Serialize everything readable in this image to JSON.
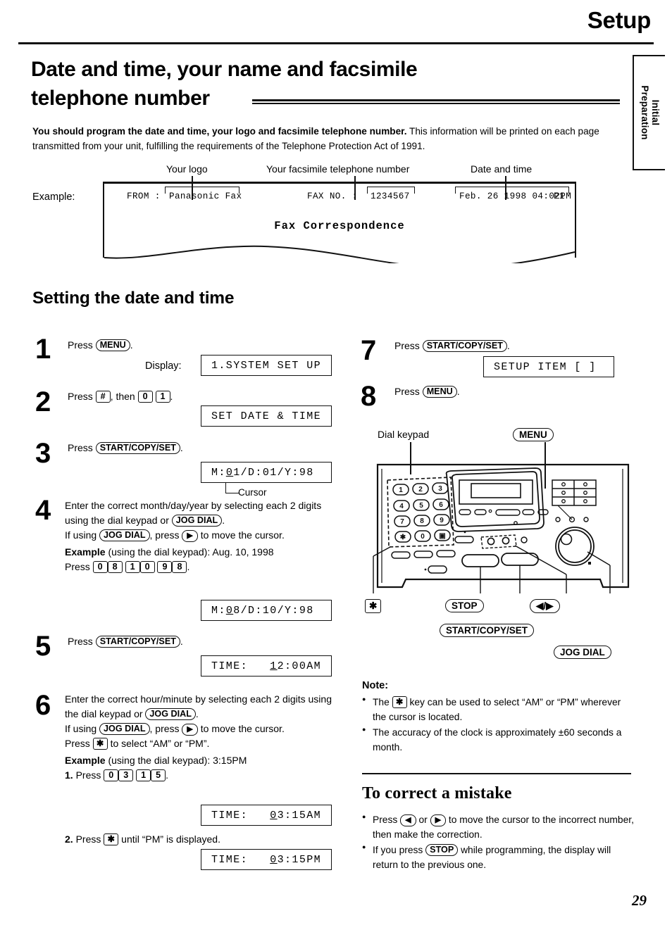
{
  "header": {
    "title": "Setup",
    "side_tab": "Initial\nPreparation",
    "side_tab_line1": "Initial",
    "side_tab_line2": "Preparation"
  },
  "section": {
    "title_line1": "Date and time, your name and facsimile",
    "title_line2": "telephone number",
    "intro_bold": "You should program the date and time, your logo and facsimile telephone number.",
    "intro_rest": " This information will be printed on each page transmitted from your unit, fulfilling the requirements of the Telephone Protection Act of 1991."
  },
  "example": {
    "label": "Example:",
    "callouts": [
      {
        "text": "Your logo"
      },
      {
        "text": "Your facsimile telephone number"
      },
      {
        "text": "Date and time"
      }
    ],
    "fax_from_label": "FROM :",
    "fax_from_value": "Panasonic Fax",
    "fax_no_label": "FAX NO. :",
    "fax_no_value": "1234567",
    "fax_datetime": "Feb. 26 1998 04:02PM",
    "fax_page": "P1",
    "fax_body": "Fax Correspondence"
  },
  "procedure": {
    "title": "Setting the date and time",
    "display_label": "Display:",
    "cursor_label": "Cursor",
    "steps": [
      {
        "num": "1",
        "line": "Press",
        "key": "MENU",
        "after": ".",
        "lcd": "1.SYSTEM SET UP"
      },
      {
        "num": "2",
        "pre": "Press",
        "key1": "#",
        "mid": ", then",
        "key2": "0",
        "key3": "1",
        "after": ".",
        "lcd": "SET DATE & TIME"
      },
      {
        "num": "3",
        "line": "Press",
        "key": "START/COPY/SET",
        "after": ".",
        "lcd_pre": "M:",
        "lcd_cursor": "0",
        "lcd_post": "1/D:01/Y:98"
      },
      {
        "num": "4",
        "p1a": "Enter the correct month/day/year by selecting each 2 digits using the dial keypad or",
        "p1key": "JOG DIAL",
        "p1b": ".",
        "p2a": "If using",
        "p2key": "JOG DIAL",
        "p2b": ", press",
        "p2arrow": "▶",
        "p2c": "to move the cursor.",
        "ex_bold": "Example",
        "ex_rest": " (using the dial keypad):  Aug. 10, 1998",
        "press": "Press",
        "keys": [
          "0",
          "8",
          "1",
          "0",
          "9",
          "8"
        ],
        "press_after": ".",
        "lcd_pre": "M:",
        "lcd_cursor": "0",
        "lcd_post": "8/D:10/Y:98"
      },
      {
        "num": "5",
        "line": "Press",
        "key": "START/COPY/SET",
        "after": ".",
        "lcd_pre": "TIME:   ",
        "lcd_cursor": "1",
        "lcd_post": "2:00AM"
      },
      {
        "num": "6",
        "p1a": "Enter the correct hour/minute by selecting each 2 digits using the dial keypad or",
        "p1key": "JOG DIAL",
        "p1b": ".",
        "p2a": "If using",
        "p2key": "JOG DIAL",
        "p2b": ", press",
        "p2arrow": "▶",
        "p2c": "to move the cursor.",
        "p3a": "Press",
        "p3key": "✱",
        "p3b": "to select “AM” or “PM”.",
        "ex_bold": "Example",
        "ex_rest": " (using the dial keypad):  3:15PM",
        "sub1_num": "1.",
        "sub1_press": "Press",
        "sub1_keys": [
          "0",
          "3",
          "1",
          "5"
        ],
        "sub1_after": ".",
        "lcd1_pre": "TIME:   ",
        "lcd1_cursor": "0",
        "lcd1_post": "3:15AM",
        "sub2_num": "2.",
        "sub2_press": "Press",
        "sub2_key": "✱",
        "sub2_after": "until “PM” is displayed.",
        "lcd2_pre": "TIME:   ",
        "lcd2_cursor": "0",
        "lcd2_post": "3:15PM"
      },
      {
        "num": "7",
        "line": "Press",
        "key": "START/COPY/SET",
        "after": ".",
        "lcd": "SETUP ITEM [   ]"
      },
      {
        "num": "8",
        "line": "Press",
        "key": "MENU",
        "after": "."
      }
    ]
  },
  "diagram": {
    "label_keypad": "Dial keypad",
    "label_menu": "MENU",
    "label_star": "✱",
    "label_stop": "STOP",
    "label_arrows_left": "◀",
    "label_arrows_sep": "/",
    "label_arrows_right": "▶",
    "label_startcopyset": "START/COPY/SET",
    "label_jogdial": "JOG DIAL",
    "keypad_keys": [
      "1",
      "2",
      "3",
      "4",
      "5",
      "6",
      "7",
      "8",
      "9",
      "✱",
      "0",
      "▣"
    ]
  },
  "note": {
    "heading": "Note:",
    "items": [
      {
        "pre": "The",
        "key": "✱",
        "post": "key can be used to select “AM” or “PM” wherever the cursor is located."
      },
      {
        "pre": "The accuracy of the clock is approximately ±60 seconds a month.",
        "key": "",
        "post": ""
      }
    ]
  },
  "correct": {
    "title": "To correct a mistake",
    "item1_a": "Press",
    "item1_key1": "◀",
    "item1_b": "or",
    "item1_key2": "▶",
    "item1_c": "to move the cursor to the incorrect number, then make the correction.",
    "item2_a": "If you press",
    "item2_key": "STOP",
    "item2_b": "while programming, the display will return to the previous one."
  },
  "footer": {
    "page_number": "29"
  },
  "colors": {
    "ink": "#111111",
    "paper": "#ffffff"
  }
}
